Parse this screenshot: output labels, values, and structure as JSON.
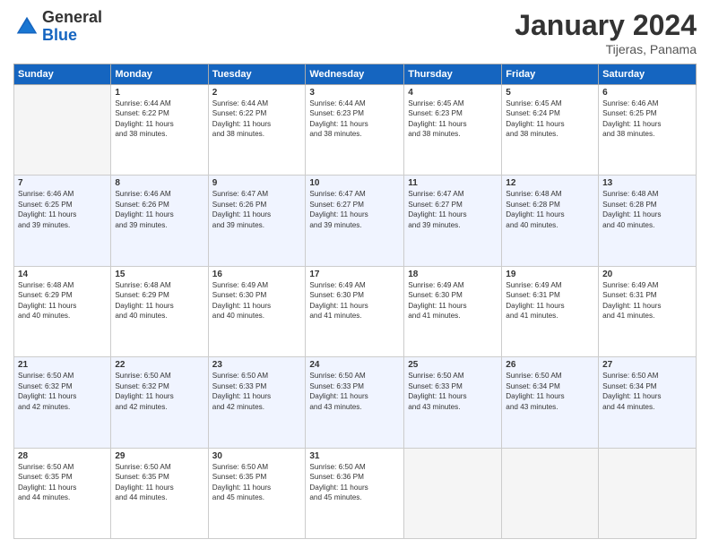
{
  "header": {
    "logo": {
      "general": "General",
      "blue": "Blue"
    },
    "title": "January 2024",
    "location": "Tijeras, Panama"
  },
  "columns": [
    "Sunday",
    "Monday",
    "Tuesday",
    "Wednesday",
    "Thursday",
    "Friday",
    "Saturday"
  ],
  "weeks": [
    {
      "days": [
        {
          "num": "",
          "content": ""
        },
        {
          "num": "1",
          "content": "Sunrise: 6:44 AM\nSunset: 6:22 PM\nDaylight: 11 hours\nand 38 minutes."
        },
        {
          "num": "2",
          "content": "Sunrise: 6:44 AM\nSunset: 6:22 PM\nDaylight: 11 hours\nand 38 minutes."
        },
        {
          "num": "3",
          "content": "Sunrise: 6:44 AM\nSunset: 6:23 PM\nDaylight: 11 hours\nand 38 minutes."
        },
        {
          "num": "4",
          "content": "Sunrise: 6:45 AM\nSunset: 6:23 PM\nDaylight: 11 hours\nand 38 minutes."
        },
        {
          "num": "5",
          "content": "Sunrise: 6:45 AM\nSunset: 6:24 PM\nDaylight: 11 hours\nand 38 minutes."
        },
        {
          "num": "6",
          "content": "Sunrise: 6:46 AM\nSunset: 6:25 PM\nDaylight: 11 hours\nand 38 minutes."
        }
      ]
    },
    {
      "days": [
        {
          "num": "7",
          "content": "Sunrise: 6:46 AM\nSunset: 6:25 PM\nDaylight: 11 hours\nand 39 minutes."
        },
        {
          "num": "8",
          "content": "Sunrise: 6:46 AM\nSunset: 6:26 PM\nDaylight: 11 hours\nand 39 minutes."
        },
        {
          "num": "9",
          "content": "Sunrise: 6:47 AM\nSunset: 6:26 PM\nDaylight: 11 hours\nand 39 minutes."
        },
        {
          "num": "10",
          "content": "Sunrise: 6:47 AM\nSunset: 6:27 PM\nDaylight: 11 hours\nand 39 minutes."
        },
        {
          "num": "11",
          "content": "Sunrise: 6:47 AM\nSunset: 6:27 PM\nDaylight: 11 hours\nand 39 minutes."
        },
        {
          "num": "12",
          "content": "Sunrise: 6:48 AM\nSunset: 6:28 PM\nDaylight: 11 hours\nand 40 minutes."
        },
        {
          "num": "13",
          "content": "Sunrise: 6:48 AM\nSunset: 6:28 PM\nDaylight: 11 hours\nand 40 minutes."
        }
      ]
    },
    {
      "days": [
        {
          "num": "14",
          "content": "Sunrise: 6:48 AM\nSunset: 6:29 PM\nDaylight: 11 hours\nand 40 minutes."
        },
        {
          "num": "15",
          "content": "Sunrise: 6:48 AM\nSunset: 6:29 PM\nDaylight: 11 hours\nand 40 minutes."
        },
        {
          "num": "16",
          "content": "Sunrise: 6:49 AM\nSunset: 6:30 PM\nDaylight: 11 hours\nand 40 minutes."
        },
        {
          "num": "17",
          "content": "Sunrise: 6:49 AM\nSunset: 6:30 PM\nDaylight: 11 hours\nand 41 minutes."
        },
        {
          "num": "18",
          "content": "Sunrise: 6:49 AM\nSunset: 6:30 PM\nDaylight: 11 hours\nand 41 minutes."
        },
        {
          "num": "19",
          "content": "Sunrise: 6:49 AM\nSunset: 6:31 PM\nDaylight: 11 hours\nand 41 minutes."
        },
        {
          "num": "20",
          "content": "Sunrise: 6:49 AM\nSunset: 6:31 PM\nDaylight: 11 hours\nand 41 minutes."
        }
      ]
    },
    {
      "days": [
        {
          "num": "21",
          "content": "Sunrise: 6:50 AM\nSunset: 6:32 PM\nDaylight: 11 hours\nand 42 minutes."
        },
        {
          "num": "22",
          "content": "Sunrise: 6:50 AM\nSunset: 6:32 PM\nDaylight: 11 hours\nand 42 minutes."
        },
        {
          "num": "23",
          "content": "Sunrise: 6:50 AM\nSunset: 6:33 PM\nDaylight: 11 hours\nand 42 minutes."
        },
        {
          "num": "24",
          "content": "Sunrise: 6:50 AM\nSunset: 6:33 PM\nDaylight: 11 hours\nand 43 minutes."
        },
        {
          "num": "25",
          "content": "Sunrise: 6:50 AM\nSunset: 6:33 PM\nDaylight: 11 hours\nand 43 minutes."
        },
        {
          "num": "26",
          "content": "Sunrise: 6:50 AM\nSunset: 6:34 PM\nDaylight: 11 hours\nand 43 minutes."
        },
        {
          "num": "27",
          "content": "Sunrise: 6:50 AM\nSunset: 6:34 PM\nDaylight: 11 hours\nand 44 minutes."
        }
      ]
    },
    {
      "days": [
        {
          "num": "28",
          "content": "Sunrise: 6:50 AM\nSunset: 6:35 PM\nDaylight: 11 hours\nand 44 minutes."
        },
        {
          "num": "29",
          "content": "Sunrise: 6:50 AM\nSunset: 6:35 PM\nDaylight: 11 hours\nand 44 minutes."
        },
        {
          "num": "30",
          "content": "Sunrise: 6:50 AM\nSunset: 6:35 PM\nDaylight: 11 hours\nand 45 minutes."
        },
        {
          "num": "31",
          "content": "Sunrise: 6:50 AM\nSunset: 6:36 PM\nDaylight: 11 hours\nand 45 minutes."
        },
        {
          "num": "",
          "content": ""
        },
        {
          "num": "",
          "content": ""
        },
        {
          "num": "",
          "content": ""
        }
      ]
    }
  ]
}
